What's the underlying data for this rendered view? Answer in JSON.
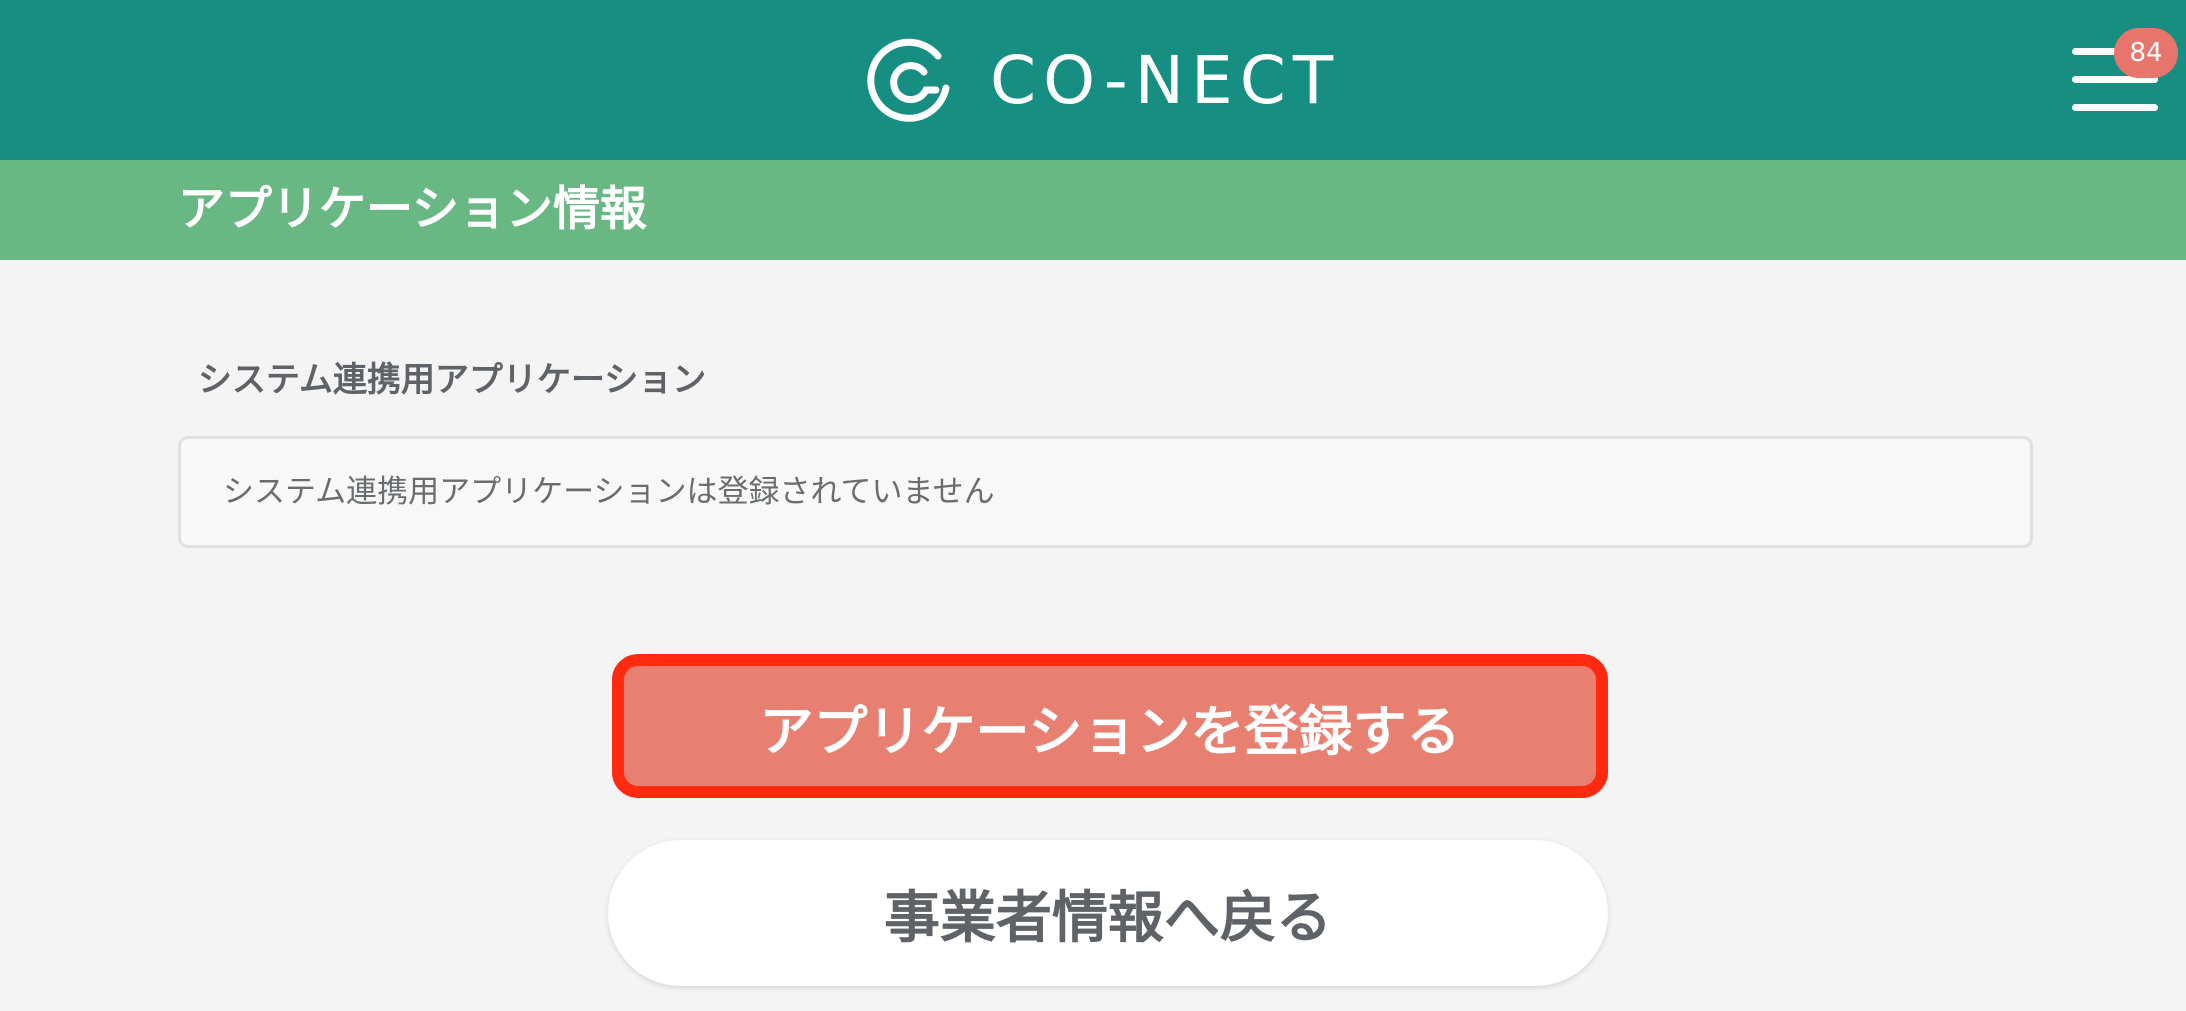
{
  "header": {
    "logo_text": "CO-NECT",
    "logo_icon": "conect-logo-mark",
    "menu_icon": "hamburger-menu-icon",
    "notification_count": "84",
    "background_color": "#168f82"
  },
  "subheader": {
    "title": "アプリケーション情報",
    "background_color": "#69b782"
  },
  "section": {
    "label": "システム連携用アプリケーション",
    "empty_message": "システム連携用アプリケーションは登録されていません"
  },
  "buttons": {
    "register_label": "アプリケーションを登録する",
    "back_label": "事業者情報へ戻る",
    "register_color": "#e88072",
    "highlight_color": "#ff2a10"
  }
}
